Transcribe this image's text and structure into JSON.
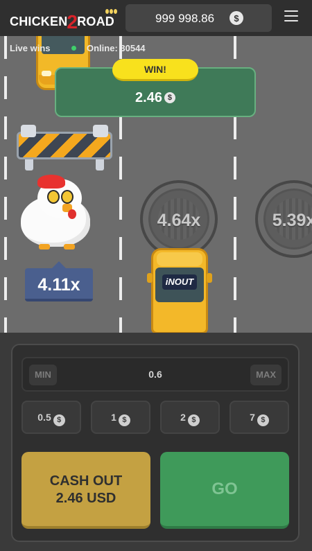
{
  "header": {
    "logo_text_left": "CHICKEN",
    "logo_text_number": "2",
    "logo_text_right": "ROAD",
    "balance": "999 998.86",
    "currency_icon": "$"
  },
  "live": {
    "live_wins_label": "Live wins",
    "online_label": "Online: 30544"
  },
  "game": {
    "win_badge": "WIN!",
    "win_amount": "2.46",
    "current_multiplier": "4.11x",
    "next_multipliers": [
      "4.64x",
      "5.39x"
    ],
    "car_sign": "iNOUT"
  },
  "controls": {
    "min_label": "MIN",
    "max_label": "MAX",
    "bet_value": "0.6",
    "quick_bets": [
      "0.5",
      "1",
      "2",
      "7"
    ],
    "cashout_line1": "CASH OUT",
    "cashout_line2": "2.46 USD",
    "go_label": "GO"
  },
  "colors": {
    "cashout": "#c4a142",
    "go": "#3f9a5a",
    "win_popup": "#3f7a58",
    "win_badge": "#f8e11d",
    "multiplier_tag": "#4a5f8e"
  }
}
